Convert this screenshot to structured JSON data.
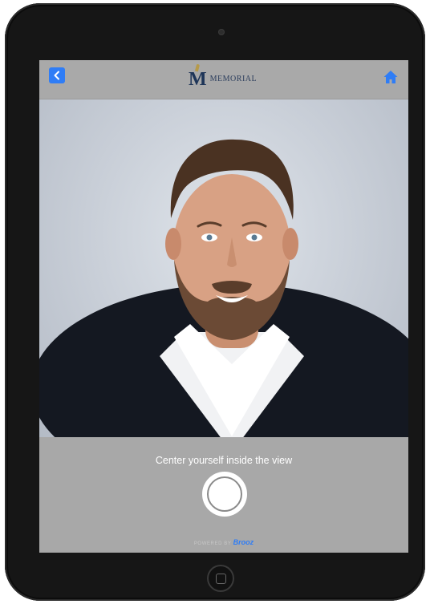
{
  "header": {
    "back_button": "back",
    "brand_initial": "M",
    "brand_name": "MEMORIAL",
    "home_button": "home"
  },
  "camera_view": {
    "subject": "portrait-preview"
  },
  "footer": {
    "prompt": "Center yourself inside the view",
    "shutter": "capture",
    "powered_prefix": "POWERED BY ",
    "powered_brand": "Brooz"
  },
  "colors": {
    "accent": "#2f7df6",
    "bar_bg": "#a8a8a8",
    "device_frame": "#161616"
  },
  "icons": [
    "chevron-left-icon",
    "house-icon",
    "shutter-icon",
    "camera-lens-icon",
    "home-button-icon"
  ]
}
